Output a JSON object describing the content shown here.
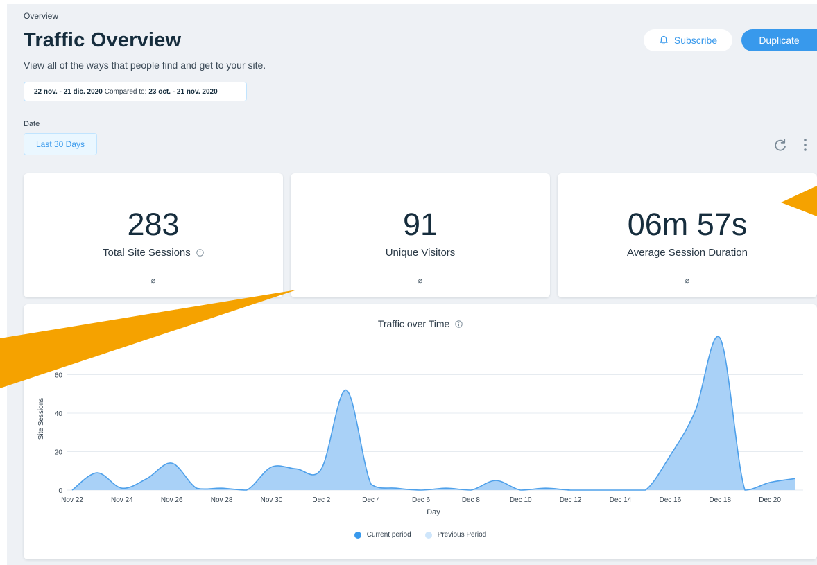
{
  "breadcrumb": "Overview",
  "page_title": "Traffic Overview",
  "page_subtitle": "View all of the ways that people find and get to your site.",
  "date_range": {
    "current": "22 nov. - 21 dic. 2020",
    "compared_label": "Compared to:",
    "previous": "23 oct. - 21 nov. 2020"
  },
  "header_buttons": {
    "subscribe_label": "Subscribe",
    "subscribe_icon": "bell-icon",
    "duplicate_label": "Duplicate"
  },
  "filters": {
    "date_label": "Date",
    "date_value": "Last 30 Days"
  },
  "toolbar_icons": [
    "refresh-icon",
    "more-vertical-icon"
  ],
  "kpis": [
    {
      "value": "283",
      "label": "Total Site Sessions",
      "info": true,
      "change": "⌀"
    },
    {
      "value": "91",
      "label": "Unique Visitors",
      "info": false,
      "change": "⌀"
    },
    {
      "value": "06m 57s",
      "label": "Average Session Duration",
      "info": false,
      "change": "⌀"
    }
  ],
  "colors": {
    "accent": "#3899ec",
    "area_fill": "#a9d1f7",
    "area_stroke": "#4ea0ea",
    "current_period": "#3899ec",
    "previous_period": "#cfe6fb",
    "annotation_arrow": "#f5a200"
  },
  "chart_data": {
    "type": "area",
    "title": "Traffic over Time",
    "xlabel": "Day",
    "ylabel": "Site Sessions",
    "ylim": [
      0,
      80
    ],
    "yticks": [
      0,
      20,
      40,
      60
    ],
    "grid": true,
    "legend_position": "bottom",
    "x": [
      "Nov 22",
      "Nov 23",
      "Nov 24",
      "Nov 25",
      "Nov 26",
      "Nov 27",
      "Nov 28",
      "Nov 29",
      "Nov 30",
      "Dec 1",
      "Dec 2",
      "Dec 3",
      "Dec 4",
      "Dec 5",
      "Dec 6",
      "Dec 7",
      "Dec 8",
      "Dec 9",
      "Dec 10",
      "Dec 11",
      "Dec 12",
      "Dec 13",
      "Dec 14",
      "Dec 15",
      "Dec 16",
      "Dec 17",
      "Dec 18",
      "Dec 19",
      "Dec 20",
      "Dec 21"
    ],
    "xtick_labels": [
      "Nov 22",
      "Nov 24",
      "Nov 26",
      "Nov 28",
      "Nov 30",
      "Dec 2",
      "Dec 4",
      "Dec 6",
      "Dec 8",
      "Dec 10",
      "Dec 12",
      "Dec 14",
      "Dec 16",
      "Dec 18",
      "Dec 20"
    ],
    "series": [
      {
        "values": [
          0,
          9,
          1,
          6,
          14,
          1,
          1,
          0,
          12,
          11,
          11,
          52,
          3,
          1,
          0,
          1,
          0,
          5,
          0,
          1,
          0,
          0,
          0,
          0,
          18,
          41,
          79,
          0,
          4,
          6
        ]
      }
    ],
    "legend": [
      {
        "label": "Current period",
        "color": "#3899ec"
      },
      {
        "label": "Previous Period",
        "color": "#cfe6fb"
      }
    ]
  }
}
